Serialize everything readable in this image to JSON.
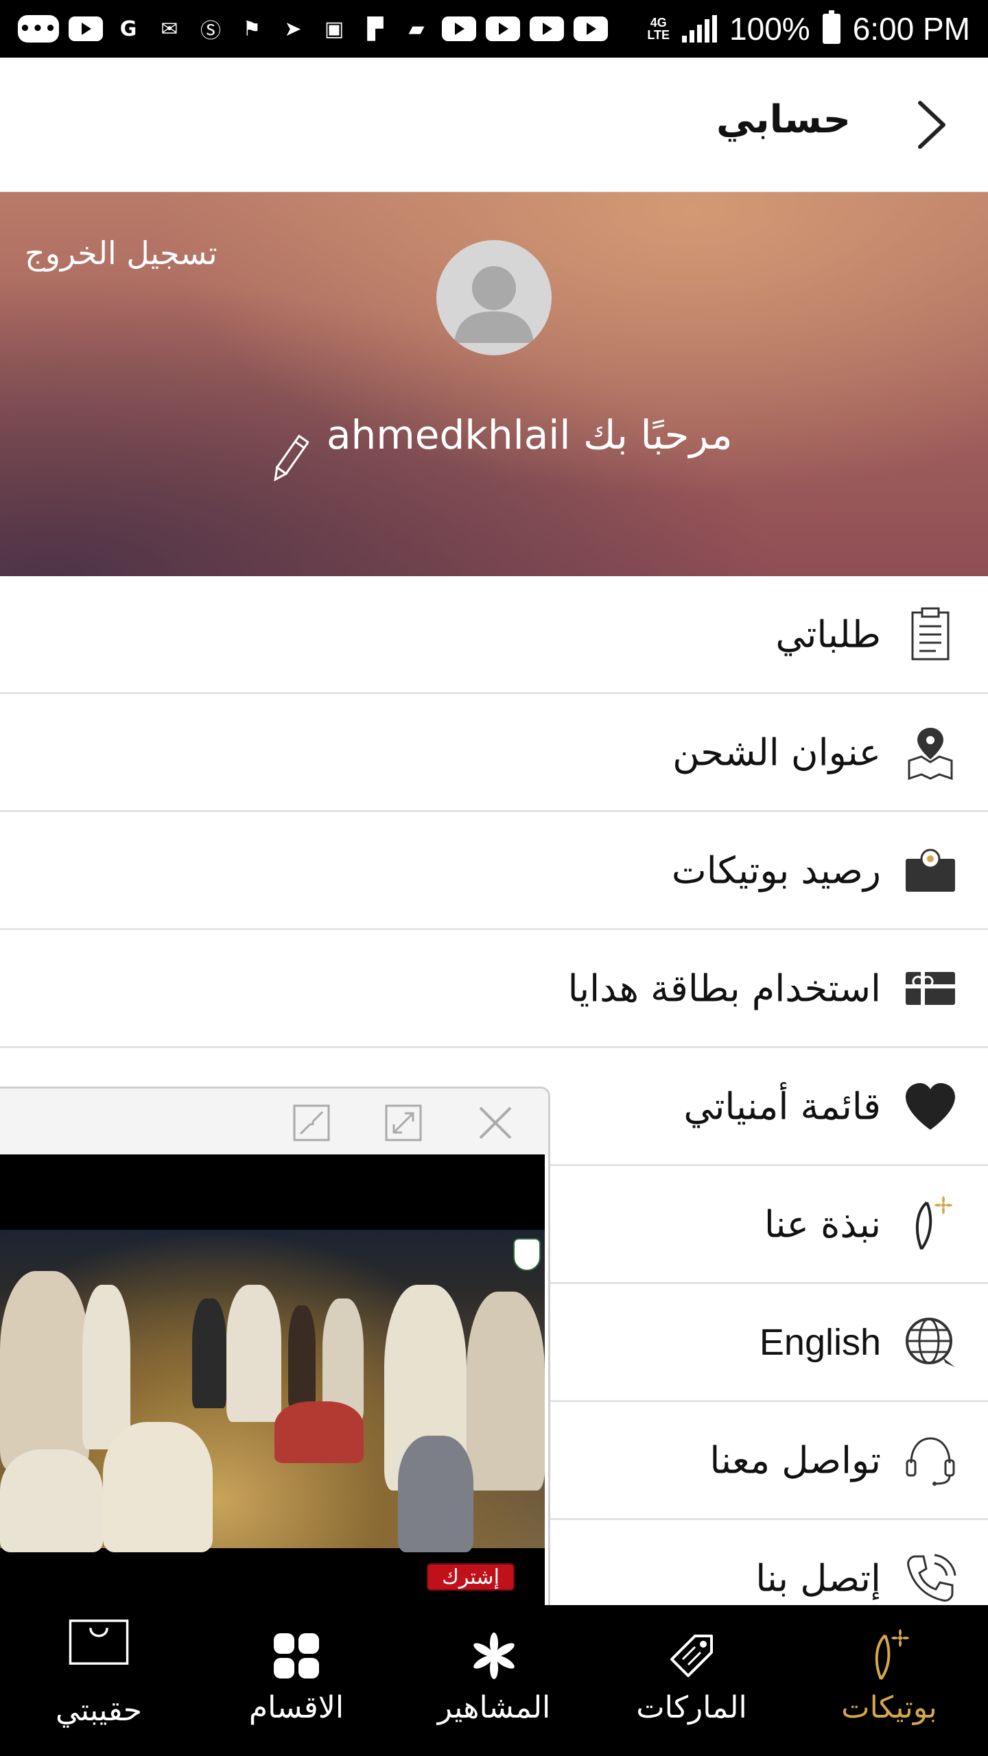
{
  "status_bar": {
    "battery": "100%",
    "time": "6:00 PM",
    "network_top": "4G",
    "network_bottom": "LTE"
  },
  "header": {
    "title": "حسابي",
    "back_icon": "chevron-right-icon"
  },
  "profile": {
    "logout_label": "تسجيل الخروج",
    "welcome_text": "مرحبًا بك ahmedkhlail",
    "avatar_icon": "avatar-placeholder-icon",
    "edit_icon": "pencil-icon"
  },
  "menu": {
    "items": [
      {
        "label": "طلباتي",
        "icon": "clipboard-icon"
      },
      {
        "label": "عنوان الشحن",
        "icon": "map-pin-icon"
      },
      {
        "label": "رصيد بوتيكات",
        "icon": "wallet-icon"
      },
      {
        "label": "استخدام بطاقة هدايا",
        "icon": "gift-card-icon"
      },
      {
        "label": "قائمة أمنياتي",
        "icon": "heart-icon"
      },
      {
        "label": "نبذة عنا",
        "icon": "boutiqaat-logo-icon"
      },
      {
        "label": "English",
        "icon": "globe-icon"
      },
      {
        "label": "تواصل معنا",
        "icon": "headset-icon"
      },
      {
        "label": "إتصل بنا",
        "icon": "phone-icon"
      }
    ]
  },
  "video_player": {
    "subscribe_label": "إشترك",
    "buttons": [
      "minimize-icon",
      "expand-icon",
      "close-icon"
    ]
  },
  "bottom_nav": {
    "items": [
      {
        "label": "حقيبتي",
        "icon": "bag-icon",
        "active": false
      },
      {
        "label": "الاقسام",
        "icon": "grid-icon",
        "active": false
      },
      {
        "label": "المشاهير",
        "icon": "flower-icon",
        "active": false
      },
      {
        "label": "الماركات",
        "icon": "tag-icon",
        "active": false
      },
      {
        "label": "بوتيكات",
        "icon": "boutiqaat-logo-icon",
        "active": true
      }
    ]
  },
  "colors": {
    "accent_gold": "#d4a74a",
    "banner_top": "#d19a74",
    "banner_bottom": "#8f4e55",
    "nav_background": "#000000"
  }
}
